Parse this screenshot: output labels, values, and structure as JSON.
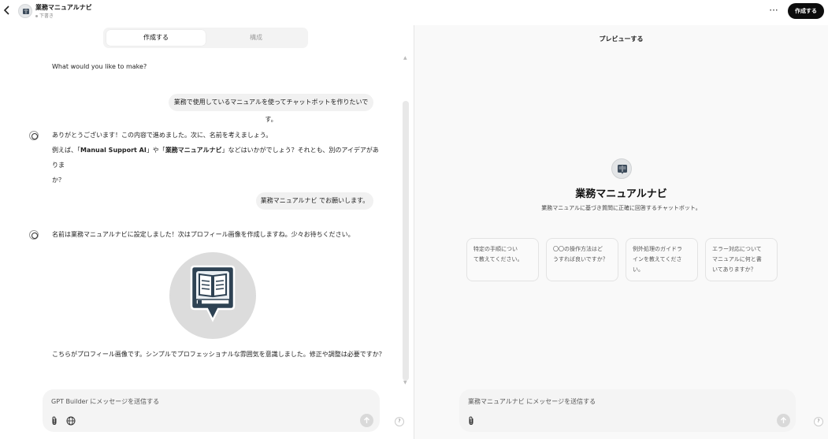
{
  "header": {
    "back_icon": "chevron-left-icon",
    "title": "業務マニュアルナビ",
    "status": "下書き",
    "more_label": "···",
    "create_label": "作成する"
  },
  "editor": {
    "tabs": [
      {
        "label": "作成する",
        "active": true
      },
      {
        "label": "構成",
        "active": false
      }
    ],
    "prompt_question": "What would you like to make?",
    "messages": [
      {
        "role": "user",
        "text": "業務で使用しているマニュアルを使ってチャットボットを作りたいです。"
      },
      {
        "role": "assistant",
        "lines": [
          "ありがとうございます！この内容で進めました。次に、名前を考えましょう。"
        ],
        "line2_prefix": "例えば、「",
        "line2_bold1": "Manual Support AI",
        "line2_mid": "」や「",
        "line2_bold2": "業務マニュアルナビ",
        "line2_suffix": "」などはいかがでしょう？それとも、別のアイデアがありま",
        "line3": "か？"
      },
      {
        "role": "user",
        "text": "業務マニュアルナビ でお願いします。"
      },
      {
        "role": "assistant",
        "text": "名前は業務マニュアルナビに設定しました！次はプロフィール画像を作成しますね。少々お待ちください。"
      },
      {
        "role": "assistant",
        "text": "こちらがプロフィール画像です。シンプルでプロフェッショナルな雰囲気を意識しました。修正や調整は必要ですか？"
      }
    ],
    "composer_placeholder": "GPT Builder にメッセージを送信する",
    "help_label": "?"
  },
  "preview": {
    "title": "プレビューする",
    "gpt_name": "業務マニュアルナビ",
    "gpt_description": "業務マニュアルに基づき質問に正確に回答するチャットボット。",
    "starters": [
      {
        "lines": [
          "特定の手順につい",
          "て教えてください。"
        ]
      },
      {
        "lines": [
          "〇〇の操作方法はど",
          "うすれば良いですか？"
        ]
      },
      {
        "lines": [
          "例外処理のガイドラ",
          "インを教えてください。"
        ]
      },
      {
        "lines": [
          "エラー対応について",
          "マニュアルに何と書",
          "いてありますか？"
        ]
      }
    ],
    "composer_placeholder": "業務マニュアルナビ にメッセージを送信する",
    "help_label": "?"
  },
  "colors": {
    "accent_button": "#0d0d0d",
    "bubble": "#f1f1f1",
    "preview_bg": "#f9f9f9"
  }
}
